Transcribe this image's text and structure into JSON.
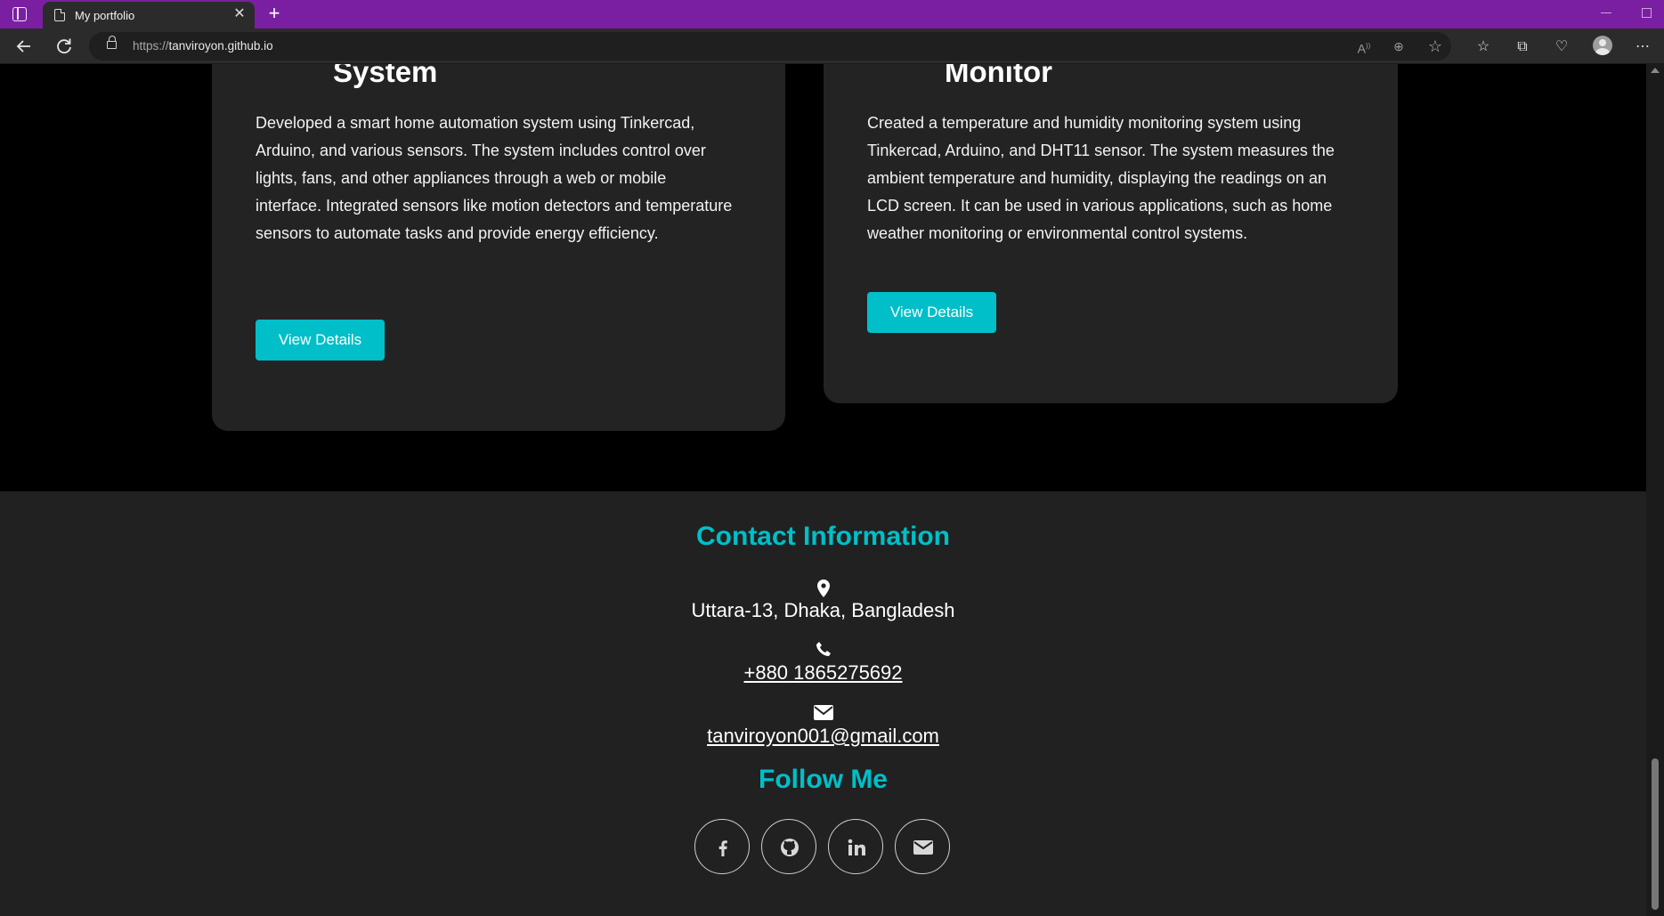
{
  "browser": {
    "tab_title": "My portfolio",
    "new_tab": "+",
    "url_protocol": "https://",
    "url_host": "tanviroyon.github.io"
  },
  "projects": [
    {
      "title": "System",
      "description": "Developed a smart home automation system using Tinkercad, Arduino, and various sensors. The system includes control over lights, fans, and other appliances through a web or mobile interface. Integrated sensors like motion detectors and temperature sensors to automate tasks and provide energy efficiency.",
      "button": "View Details"
    },
    {
      "title": "Monitor",
      "description": "Created a temperature and humidity monitoring system using Tinkercad, Arduino, and DHT11 sensor. The system measures the ambient temperature and humidity, displaying the readings on an LCD screen. It can be used in various applications, such as home weather monitoring or environmental control systems.",
      "button": "View Details"
    }
  ],
  "contact": {
    "heading": "Contact Information",
    "address": "Uttara-13, Dhaka, Bangladesh",
    "phone": "+880 1865275692",
    "email": "tanviroyon001@gmail.com"
  },
  "follow": {
    "heading": "Follow Me",
    "icons": [
      "facebook-icon",
      "github-icon",
      "linkedin-icon",
      "email-icon"
    ]
  },
  "colors": {
    "accent": "#00bfc8",
    "titlebar": "#7b1fa2",
    "card": "#232323",
    "footer": "#212121"
  }
}
